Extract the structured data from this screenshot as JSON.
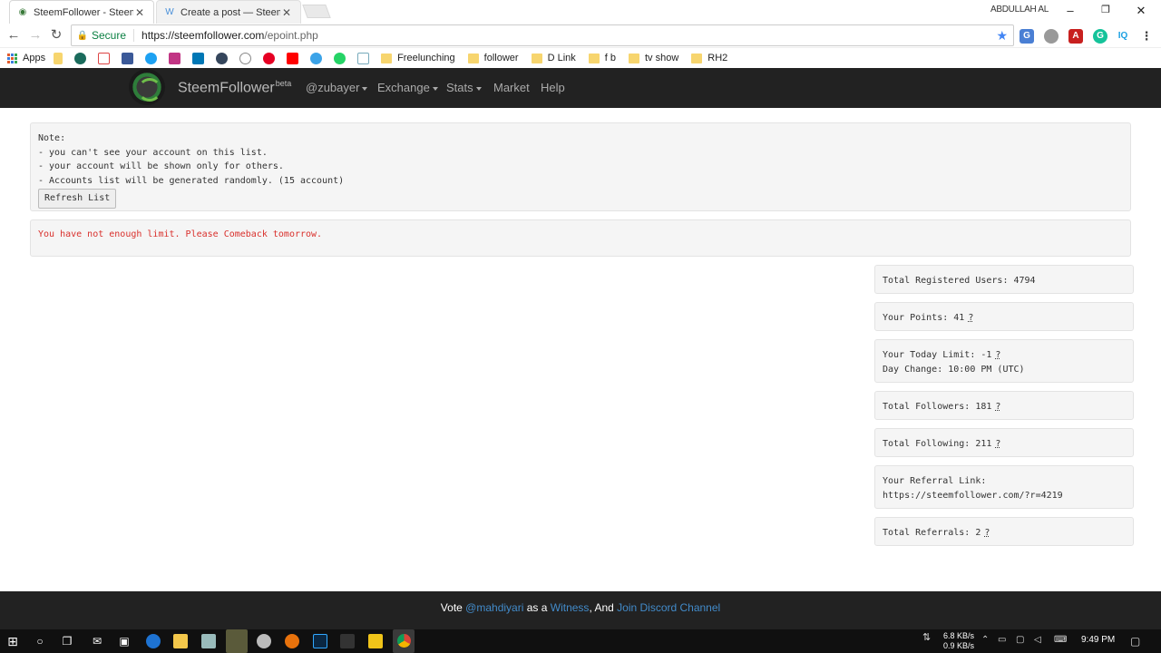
{
  "browser": {
    "tabs": [
      {
        "title": "SteemFollower - Steem U",
        "active": true
      },
      {
        "title": "Create a post — Steemit",
        "active": false
      }
    ],
    "profile": "ABDULLAH AL",
    "secure_label": "Secure",
    "url_host": "https://steemfollower.com",
    "url_path": "/epoint.php",
    "bookmarks": {
      "apps": "Apps",
      "folders": [
        "Freelunching",
        "follower",
        "D Link",
        "f b",
        "tv show",
        "RH2"
      ]
    }
  },
  "site": {
    "brand": "SteemFollower",
    "brand_sup": "beta",
    "nav": {
      "user": "@zubayer",
      "exchange": "Exchange",
      "stats": "Stats",
      "market": "Market",
      "help": "Help"
    }
  },
  "note": {
    "heading": "Note:",
    "lines": [
      "- you can't see your account on this list.",
      "- your account will be shown only for others.",
      "- Accounts list will be generated randomly. (15 account)"
    ],
    "refresh_label": "Refresh List"
  },
  "limit_message": "You have not enough limit. Please Comeback tomorrow.",
  "stats": {
    "registered": "Total Registered Users: 4794",
    "points": "Your Points: 41",
    "today_limit": "Your Today Limit: -1",
    "day_change": "Day Change: 10:00 PM (UTC)",
    "followers": "Total Followers: 181",
    "following": "Total Following: 211",
    "referral_label": "Your Referral Link:",
    "referral_url": "https://steemfollower.com/?r=4219",
    "referrals": "Total Referrals: 2",
    "help_mark": "?"
  },
  "footer": {
    "vote": "Vote",
    "witness_user": "@mahdiyari",
    "as_a": "as a",
    "witness": "Witness",
    "and": ", And",
    "discord": "Join Discord Channel"
  },
  "taskbar": {
    "net_up": "6.8 KB/s",
    "net_down": "0.9 KB/s",
    "time": "9:49 PM"
  },
  "colors": {
    "navbar_bg": "#222222",
    "error_text": "#d9302c",
    "link": "#428bca",
    "secure_green": "#0b8043"
  }
}
